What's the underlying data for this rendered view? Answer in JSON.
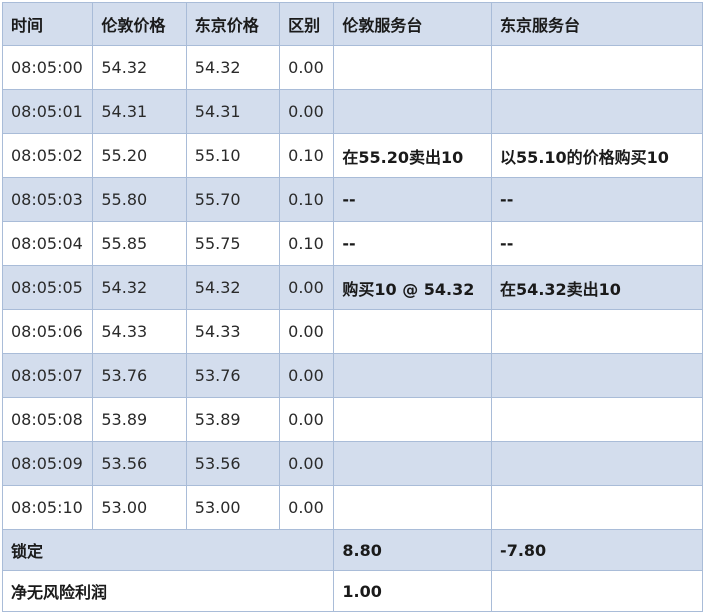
{
  "table": {
    "headers": [
      "时间",
      "伦敦价格",
      "东京价格",
      "区别",
      "伦敦服务台",
      "东京服务台"
    ],
    "rows": [
      {
        "time": "08:05:00",
        "london": "54.32",
        "tokyo": "54.32",
        "diff": "0.00",
        "london_desk": "",
        "tokyo_desk": ""
      },
      {
        "time": "08:05:01",
        "london": "54.31",
        "tokyo": "54.31",
        "diff": "0.00",
        "london_desk": "",
        "tokyo_desk": ""
      },
      {
        "time": "08:05:02",
        "london": "55.20",
        "tokyo": "55.10",
        "diff": "0.10",
        "london_desk": "在55.20卖出10",
        "tokyo_desk": "以55.10的价格购买10"
      },
      {
        "time": "08:05:03",
        "london": "55.80",
        "tokyo": "55.70",
        "diff": "0.10",
        "london_desk": "--",
        "tokyo_desk": "--"
      },
      {
        "time": "08:05:04",
        "london": "55.85",
        "tokyo": "55.75",
        "diff": "0.10",
        "london_desk": "--",
        "tokyo_desk": "--"
      },
      {
        "time": "08:05:05",
        "london": "54.32",
        "tokyo": "54.32",
        "diff": "0.00",
        "london_desk": "购买10 @ 54.32",
        "tokyo_desk": "在54.32卖出10"
      },
      {
        "time": "08:05:06",
        "london": "54.33",
        "tokyo": "54.33",
        "diff": "0.00",
        "london_desk": "",
        "tokyo_desk": ""
      },
      {
        "time": "08:05:07",
        "london": "53.76",
        "tokyo": "53.76",
        "diff": "0.00",
        "london_desk": "",
        "tokyo_desk": ""
      },
      {
        "time": "08:05:08",
        "london": "53.89",
        "tokyo": "53.89",
        "diff": "0.00",
        "london_desk": "",
        "tokyo_desk": ""
      },
      {
        "time": "08:05:09",
        "london": "53.56",
        "tokyo": "53.56",
        "diff": "0.00",
        "london_desk": "",
        "tokyo_desk": ""
      },
      {
        "time": "08:05:10",
        "london": "53.00",
        "tokyo": "53.00",
        "diff": "0.00",
        "london_desk": "",
        "tokyo_desk": ""
      }
    ],
    "summary": {
      "locked_label": "锁定",
      "locked_london": "8.80",
      "locked_tokyo": "-7.80",
      "profit_label": "净无风险利润",
      "profit_value": "1.00"
    }
  }
}
